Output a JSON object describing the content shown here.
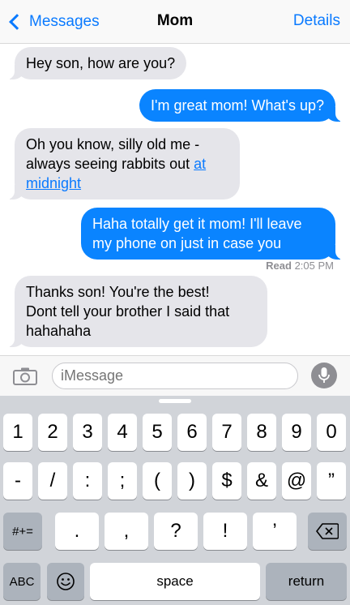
{
  "nav": {
    "back_label": "Messages",
    "title": "Mom",
    "details_label": "Details"
  },
  "messages": [
    {
      "from": "in",
      "text": "Hey son, how are you?"
    },
    {
      "from": "out",
      "text": "I'm great mom! What's up?"
    },
    {
      "from": "in",
      "text": "Oh you know, silly old me -",
      "line2": "always seeing rabbits out",
      "link_part1": "at",
      "link_part2": "midnight"
    },
    {
      "from": "out",
      "text": "Haha totally get it mom! I'll leave",
      "line2": "my phone on just in case you"
    },
    {
      "from": "in",
      "text": "Thanks son! You're the best!",
      "line2": "Dont tell your brother I said that",
      "line3": "hahahaha"
    }
  ],
  "receipt": {
    "label": "Read",
    "time": "2:05 PM"
  },
  "input": {
    "placeholder": "iMessage"
  },
  "icons": {
    "camera": "camera-icon",
    "mic": "microphone-icon",
    "emoji": "emoji-icon",
    "delete": "backspace-icon"
  },
  "keyboard": {
    "row1": [
      "1",
      "2",
      "3",
      "4",
      "5",
      "6",
      "7",
      "8",
      "9",
      "0"
    ],
    "row2": [
      "-",
      "/",
      ":",
      ";",
      "(",
      ")",
      "$",
      "&",
      "@",
      "”"
    ],
    "row3_mode": "#+=",
    "row3": [
      ".",
      ",",
      "?",
      "!",
      "’"
    ],
    "abc": "ABC",
    "space": "space",
    "return": "return"
  },
  "colors": {
    "accent": "#0a7aff",
    "outgoing_bubble": "#0a84ff",
    "incoming_bubble": "#e5e5ea",
    "keyboard_bg": "#d1d4d9"
  }
}
